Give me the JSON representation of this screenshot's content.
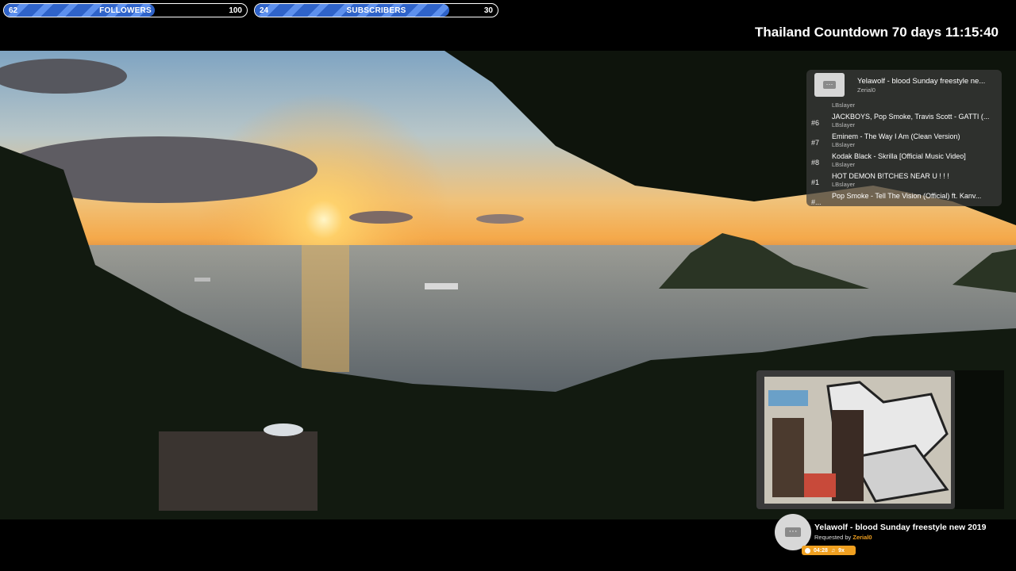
{
  "followers": {
    "current": "62",
    "label": "FOLLOWERS",
    "goal": "100",
    "fraction": 0.62
  },
  "subscribers": {
    "current": "24",
    "label": "SUBSCRIBERS",
    "goal": "30",
    "fraction": 0.8
  },
  "countdown": "Thailand Countdown 70 days 11:15:40",
  "queue": {
    "current_title": "Yelawolf - blood Sunday freestyle ne...",
    "current_user": "Zerial0",
    "top_user": "LBslayer",
    "items": [
      {
        "num": "#6",
        "title": "JACKBOYS, Pop Smoke, Travis Scott - GATTI (...",
        "user": "LBslayer"
      },
      {
        "num": "#7",
        "title": "Eminem - The Way I Am (Clean Version)",
        "user": "LBslayer"
      },
      {
        "num": "#8",
        "title": "Kodak Black - Skrilla [Official Music Video]",
        "user": "LBslayer"
      },
      {
        "num": "#1",
        "title": "HOT DEMON B!TCHES NEAR U ! ! !",
        "user": "LBslayer"
      },
      {
        "num": "#...",
        "title": "Pop Smoke - Tell The Vision (Official) ft. Kanv...",
        "user": ""
      }
    ]
  },
  "now_playing": {
    "title": "Yelawolf - blood Sunday freestyle new 2019",
    "requested_prefix": "Requested by",
    "requester": "Zerial0",
    "time": "04:28",
    "plays": "9x"
  },
  "icons": {
    "menu": "more-dots-icon",
    "clock": "clock-icon",
    "music": "music-note-icon"
  }
}
